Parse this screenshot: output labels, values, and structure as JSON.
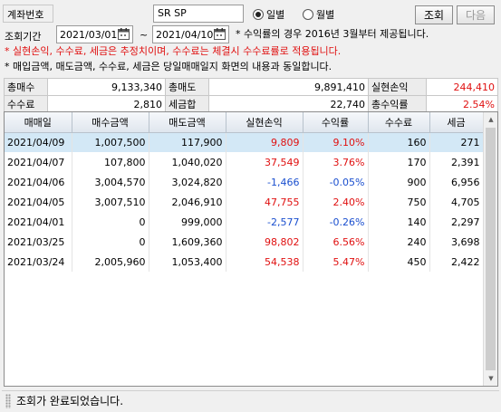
{
  "account": {
    "label": "계좌번호",
    "value": "SR SP"
  },
  "view_mode": {
    "options": [
      {
        "label": "일별",
        "selected": true
      },
      {
        "label": "월별",
        "selected": false
      }
    ]
  },
  "buttons": {
    "inquiry": "조회",
    "next": "다음"
  },
  "period": {
    "label": "조회기간",
    "start": "2021/03/01",
    "separator": "~",
    "end": "2021/04/10",
    "note": "* 수익률의 경우 2016년 3월부터 제공됩니다."
  },
  "notes": [
    "* 실현손익, 수수료, 세금은 추정치이며, 수수료는 체결시 수수료률로 적용됩니다.",
    "* 매입금액, 매도금액, 수수료, 세금은 당일매매일지 화면의 내용과 동일합니다."
  ],
  "summary": {
    "row1": [
      {
        "label": "총매수",
        "value": "9,133,340"
      },
      {
        "label": "총매도",
        "value": "9,891,410"
      },
      {
        "label": "실현손익",
        "value": "244,410"
      }
    ],
    "row2": [
      {
        "label": "수수료",
        "value": "2,810"
      },
      {
        "label": "세금합",
        "value": "22,740"
      },
      {
        "label": "총수익률",
        "value": "2.54%"
      }
    ]
  },
  "table": {
    "columns": [
      "매매일",
      "매수금액",
      "매도금액",
      "실현손익",
      "수익률",
      "수수료",
      "세금"
    ],
    "rows": [
      [
        "2021/04/09",
        "1,007,500",
        "117,900",
        "9,809",
        "9.10%",
        "160",
        "271"
      ],
      [
        "2021/04/07",
        "107,800",
        "1,040,020",
        "37,549",
        "3.76%",
        "170",
        "2,391"
      ],
      [
        "2021/04/06",
        "3,004,570",
        "3,024,820",
        "-1,466",
        "-0.05%",
        "900",
        "6,956"
      ],
      [
        "2021/04/05",
        "3,007,510",
        "2,046,910",
        "47,755",
        "2.40%",
        "750",
        "4,705"
      ],
      [
        "2021/04/01",
        "0",
        "999,000",
        "-2,577",
        "-0.26%",
        "140",
        "2,297"
      ],
      [
        "2021/03/25",
        "0",
        "1,609,360",
        "98,802",
        "6.56%",
        "240",
        "3,698"
      ],
      [
        "2021/03/24",
        "2,005,960",
        "1,053,400",
        "54,538",
        "5.47%",
        "450",
        "2,422"
      ]
    ]
  },
  "status": "조회가 완료되었습니다.",
  "colors": {
    "positive": "#e01010",
    "negative": "#1a4fcf",
    "selected_row": "#d3e8f6"
  },
  "icons": [
    "calendar-icon",
    "scroll-up-icon",
    "scroll-down-icon"
  ]
}
